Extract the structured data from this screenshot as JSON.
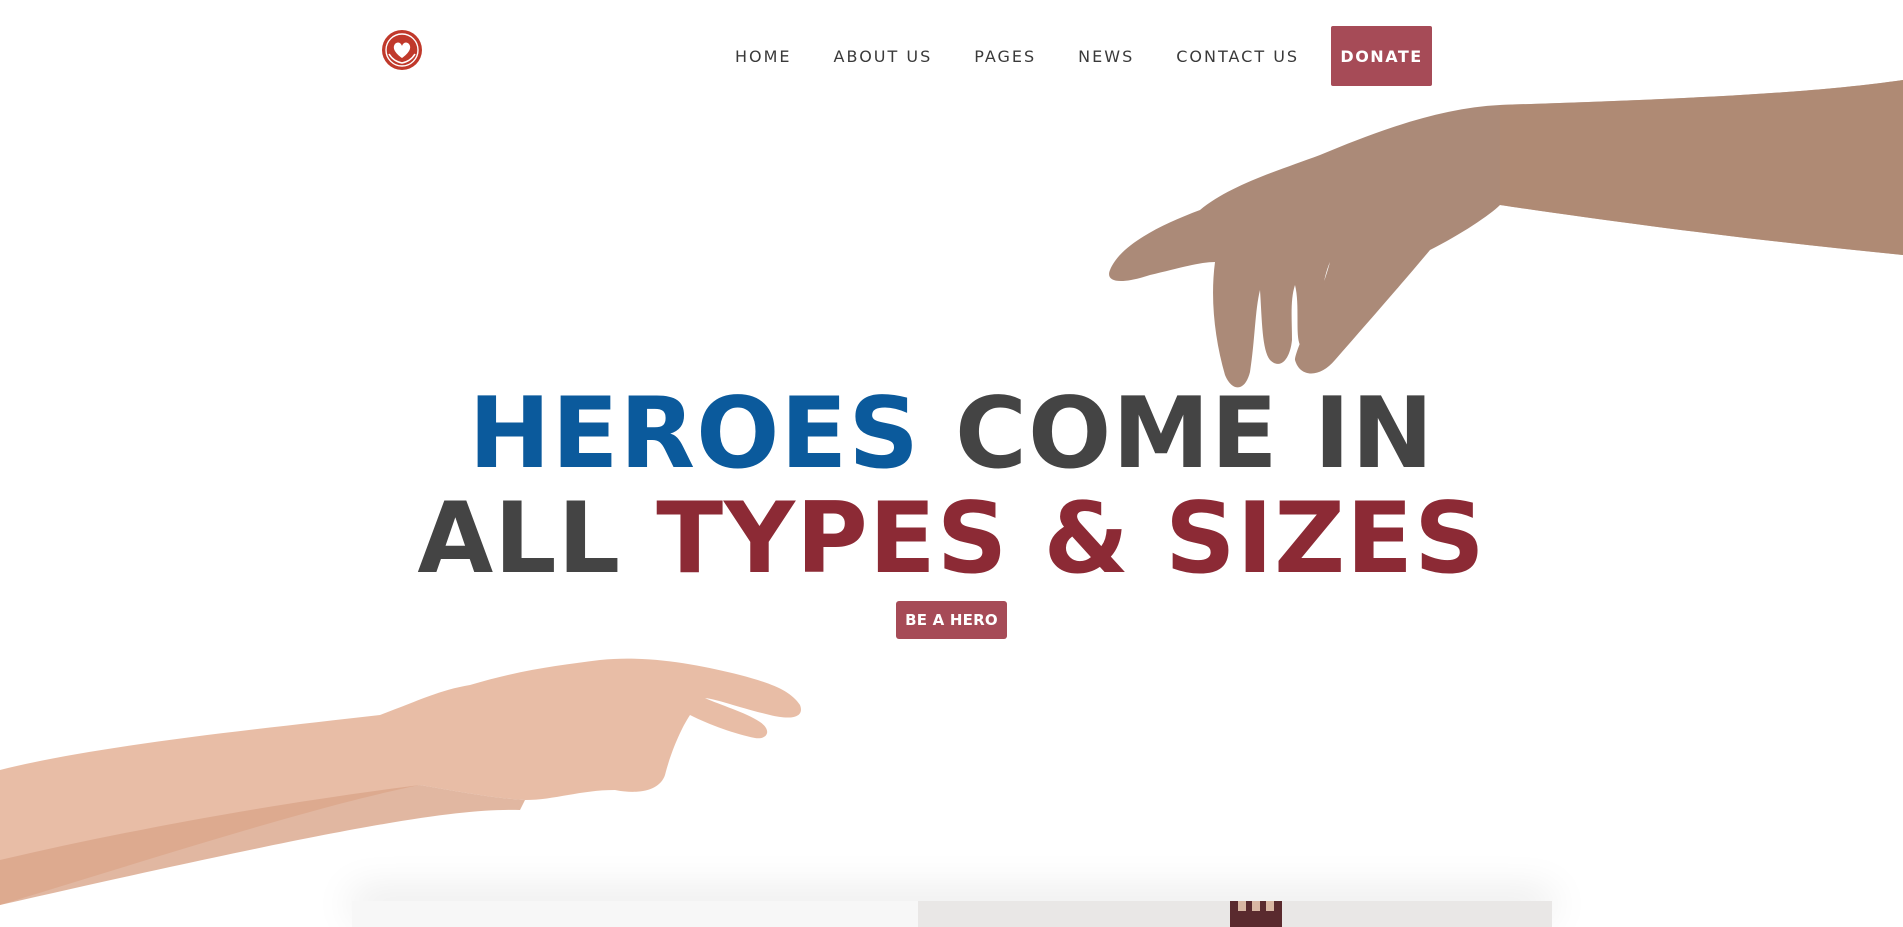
{
  "nav": {
    "items": [
      {
        "label": "HOME"
      },
      {
        "label": "ABOUT US"
      },
      {
        "label": "PAGES"
      },
      {
        "label": "NEWS"
      },
      {
        "label": "CONTACT US"
      }
    ],
    "donate_label": "DONATE"
  },
  "hero": {
    "line1_part1": "HEROES",
    "line1_part2": "COME IN",
    "line2_part1": "ALL",
    "line2_part2": "TYPES & SIZES",
    "cta_label": "BE A HERO"
  },
  "colors": {
    "accent": "#a64b57",
    "blue": "#0b5a9c",
    "dark": "#444444",
    "red": "#8c2a35"
  },
  "icons": {
    "logo": "hands-heart-emblem"
  }
}
